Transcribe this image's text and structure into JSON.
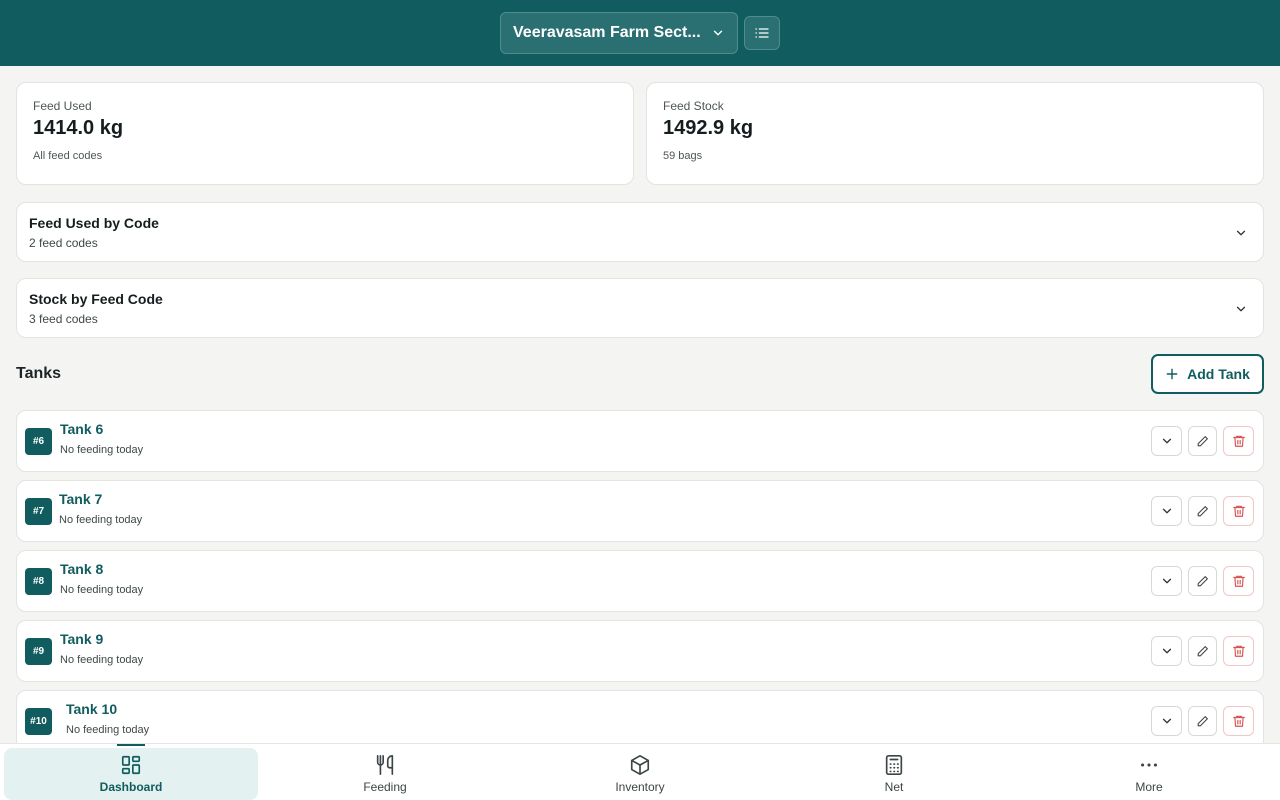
{
  "header": {
    "farm_name": "Veeravasam Farm Sect..."
  },
  "stats": {
    "feed_used": {
      "label": "Feed Used",
      "value": "1414.0 kg",
      "sub": "All feed codes"
    },
    "feed_stock": {
      "label": "Feed Stock",
      "value": "1492.9 kg",
      "sub": "59 bags"
    }
  },
  "collapsibles": {
    "used_by_code": {
      "title": "Feed Used by Code",
      "sub": "2 feed codes"
    },
    "stock_by_code": {
      "title": "Stock by Feed Code",
      "sub": "3 feed codes"
    }
  },
  "tanks_section": {
    "title": "Tanks",
    "add_label": "Add Tank"
  },
  "tanks": [
    {
      "badge": "#6",
      "name": "Tank 6",
      "status": "No feeding today"
    },
    {
      "badge": "#7",
      "name": "Tank 7",
      "status": "No feeding today"
    },
    {
      "badge": "#8",
      "name": "Tank 8",
      "status": "No feeding today"
    },
    {
      "badge": "#9",
      "name": "Tank 9",
      "status": "No feeding today"
    },
    {
      "badge": "#10",
      "name": "Tank 10",
      "status": "No feeding today"
    }
  ],
  "nav": {
    "dashboard": "Dashboard",
    "feeding": "Feeding",
    "inventory": "Inventory",
    "net": "Net",
    "more": "More"
  },
  "colors": {
    "primary": "#115c5e",
    "danger": "#d9534f",
    "background": "#f4f5f2"
  },
  "icons": [
    "chevron-down-icon",
    "list-icon",
    "plus-icon",
    "pencil-icon",
    "trash-icon",
    "dashboard-icon",
    "utensils-icon",
    "box-icon",
    "calculator-icon",
    "more-icon"
  ]
}
